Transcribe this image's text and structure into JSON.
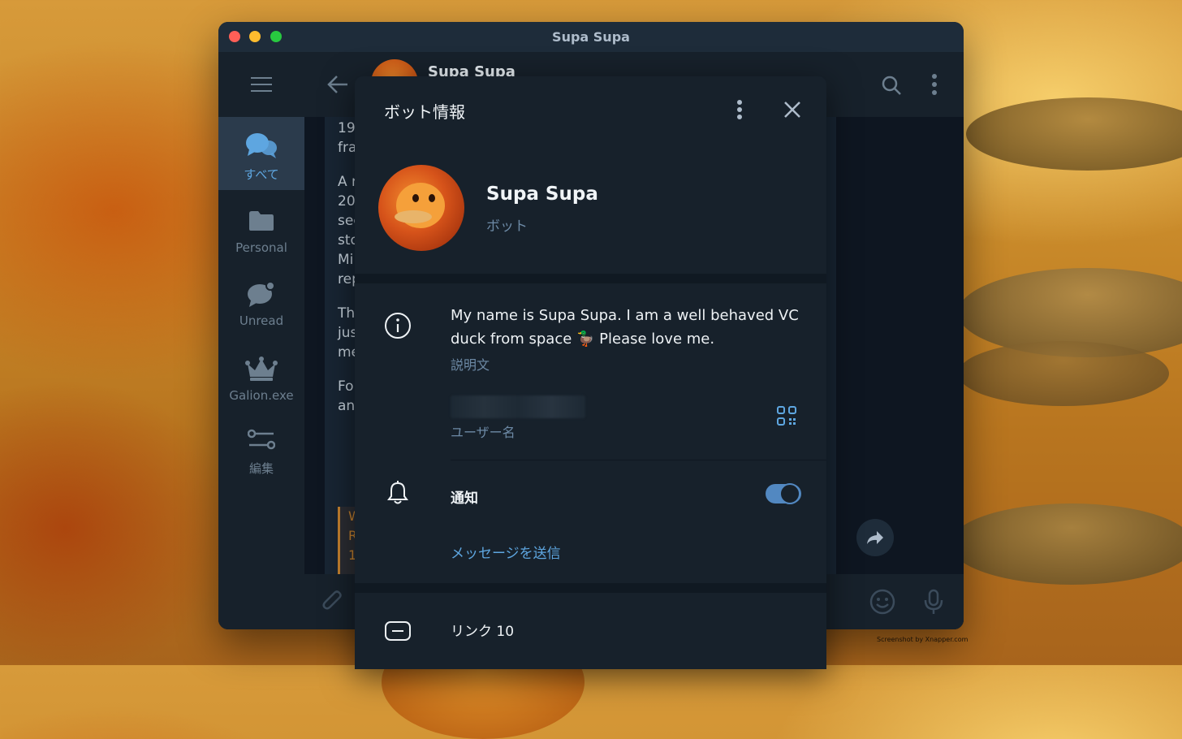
{
  "window": {
    "title": "Supa Supa"
  },
  "sidebar": {
    "folders": [
      {
        "label": "すべて",
        "icon": "chats-icon",
        "active": true
      },
      {
        "label": "Personal",
        "icon": "folder-icon"
      },
      {
        "label": "Unread",
        "icon": "unread-chat-icon"
      },
      {
        "label": "Galion.exe",
        "icon": "crown-icon"
      },
      {
        "label": "編集",
        "icon": "edit-folders-icon"
      }
    ]
  },
  "chat": {
    "title": "Supa Supa",
    "message_fragments": [
      "19\nfra",
      "A r\n20\nsec\nsto\nMi\nrep",
      "Th\njus\nme",
      "Fo\nan"
    ],
    "quote_fragment": "W\nR\n1"
  },
  "panel": {
    "title": "ボット情報",
    "bot_name": "Supa Supa",
    "bot_type": "ボット",
    "description": "My name is Supa Supa. I am a well behaved VC duck from space 🦆 Please love me.",
    "description_label": "説明文",
    "username_label": "ユーザー名",
    "notifications_label": "通知",
    "notifications_enabled": true,
    "send_message_label": "メッセージを送信",
    "links_label": "リンク 10"
  },
  "colors": {
    "accent": "#5288c1",
    "link": "#5ea6e0",
    "panel_bg": "#17212b"
  },
  "watermark": "Screenshot by Xnapper.com"
}
